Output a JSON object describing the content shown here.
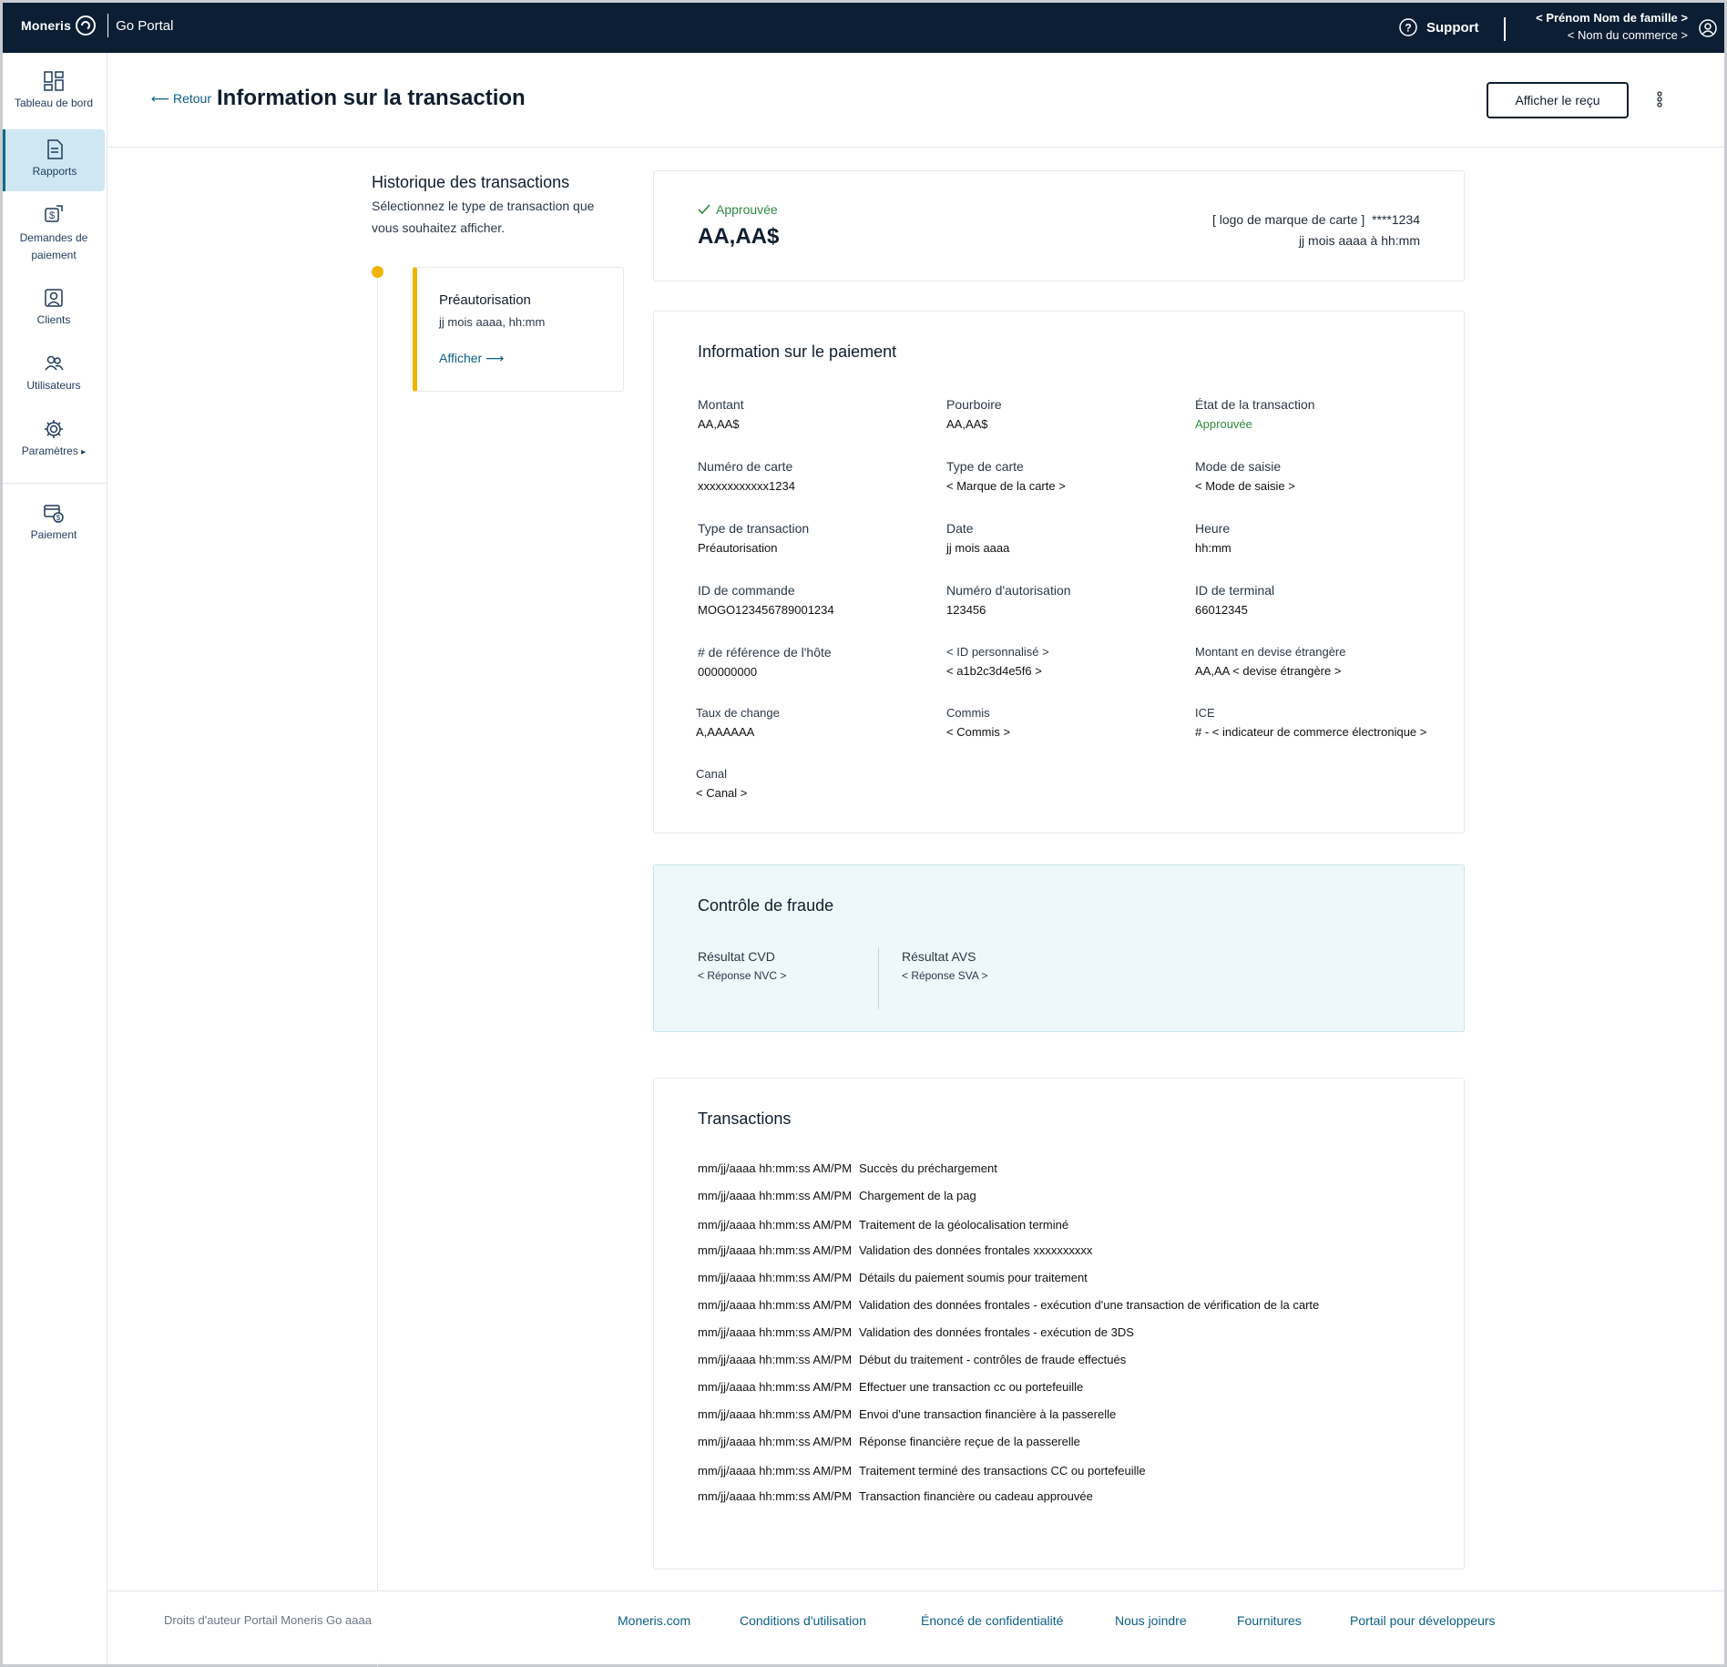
{
  "topbar": {
    "brand": "Moneris",
    "product": "Go Portal",
    "support": "Support",
    "user_name": "< Prénom Nom de famille >",
    "merchant_name": "< Nom du commerce >"
  },
  "sidebar": {
    "items": [
      {
        "label": "Tableau de bord",
        "icon": "dashboard-icon"
      },
      {
        "label": "Rapports",
        "icon": "reports-icon"
      },
      {
        "label": "Demandes de paiement",
        "icon": "payment-requests-icon"
      },
      {
        "label": "Clients",
        "icon": "clients-icon"
      },
      {
        "label": "Utilisateurs",
        "icon": "users-icon"
      },
      {
        "label": "Paramètres",
        "icon": "gear-icon"
      },
      {
        "label": "Paiement",
        "icon": "payment-icon"
      }
    ],
    "active": "Rapports"
  },
  "header": {
    "back": "Retour",
    "title": "Information sur la transaction",
    "receipt_button": "Afficher le reçu"
  },
  "history": {
    "title": "Historique des transactions",
    "subtitle": "Sélectionnez le type de transaction que vous souhaitez afficher.",
    "item": {
      "type": "Préautorisation",
      "date": "jj mois aaaa, hh:mm",
      "link": "Afficher"
    }
  },
  "summary": {
    "status": "Approuvée",
    "amount": "AA,AA$",
    "card_brand": "[ logo de marque de carte ]",
    "card_mask": "****1234",
    "datetime": "jj mois aaaa à hh:mm"
  },
  "payment": {
    "title": "Information sur le paiement",
    "fields": [
      {
        "label": "Montant",
        "value": "AA,AA$"
      },
      {
        "label": "Pourboire",
        "value": "AA,AA$"
      },
      {
        "label": "État de la transaction",
        "value": "Approuvée"
      },
      {
        "label": "Numéro de carte",
        "value": "xxxxxxxxxxxx1234"
      },
      {
        "label": "Type de carte",
        "value": "< Marque de la carte >"
      },
      {
        "label": "Mode de saisie",
        "value": "< Mode de saisie >"
      },
      {
        "label": "Type de transaction",
        "value": "Préautorisation"
      },
      {
        "label": "Date",
        "value": "jj mois aaaa"
      },
      {
        "label": "Heure",
        "value": "hh:mm"
      },
      {
        "label": "ID de commande",
        "value": "MOGO123456789001234"
      },
      {
        "label": "Numéro d'autorisation",
        "value": "123456"
      },
      {
        "label": "ID de terminal",
        "value": "66012345"
      },
      {
        "label": "# de référence de l'hôte",
        "value": "000000000"
      },
      {
        "label": "< ID personnalisé >",
        "value": "< a1b2c3d4e5f6 >"
      },
      {
        "label": "Montant en devise étrangère",
        "value": "AA,AA < devise étrangère >"
      },
      {
        "label": "Taux de change",
        "value": "A,AAAAAA"
      },
      {
        "label": "Commis",
        "value": "< Commis >"
      },
      {
        "label": "ICE",
        "value": "# - < indicateur de commerce électronique >"
      },
      {
        "label": "Canal",
        "value": "< Canal >"
      }
    ]
  },
  "fraud": {
    "title": "Contrôle de fraude",
    "cvd_label": "Résultat CVD",
    "cvd_value": "< Réponse NVC >",
    "avs_label": "Résultat AVS",
    "avs_value": "< Réponse SVA >"
  },
  "transactions": {
    "title": "Transactions",
    "rows": [
      {
        "ts": "mm/jj/aaaa hh:mm:ss AM/PM",
        "msg": "Succès du préchargement"
      },
      {
        "ts": "mm/jj/aaaa hh:mm:ss AM/PM",
        "msg": "Chargement de la pag"
      },
      {
        "ts": "mm/jj/aaaa hh:mm:ss AM/PM",
        "msg": "Traitement de la géolocalisation terminé"
      },
      {
        "ts": "mm/jj/aaaa hh:mm:ss AM/PM",
        "msg": "Validation des données frontales xxxxxxxxxx"
      },
      {
        "ts": "mm/jj/aaaa hh:mm:ss AM/PM",
        "msg": "Détails du paiement soumis pour traitement"
      },
      {
        "ts": "mm/jj/aaaa hh:mm:ss AM/PM",
        "msg": "Validation des données frontales - exécution d'une transaction de vérification de la carte"
      },
      {
        "ts": "mm/jj/aaaa hh:mm:ss AM/PM",
        "msg": "Validation des données frontales - exécution de 3DS"
      },
      {
        "ts": "mm/jj/aaaa hh:mm:ss AM/PM",
        "msg": "Début du traitement - contrôles de fraude effectués"
      },
      {
        "ts": "mm/jj/aaaa hh:mm:ss AM/PM",
        "msg": "Effectuer une transaction cc ou portefeuille"
      },
      {
        "ts": "mm/jj/aaaa hh:mm:ss AM/PM",
        "msg": "Envoi d'une transaction financière à la passerelle"
      },
      {
        "ts": "mm/jj/aaaa hh:mm:ss AM/PM",
        "msg": "Réponse financière reçue de la passerelle"
      },
      {
        "ts": "mm/jj/aaaa hh:mm:ss AM/PM",
        "msg": "Traitement terminé des transactions CC ou portefeuille"
      },
      {
        "ts": "mm/jj/aaaa hh:mm:ss AM/PM",
        "msg": "Transaction financière ou cadeau approuvée"
      }
    ]
  },
  "footer": {
    "copyright": "Droits d'auteur Portail Moneris Go  aaaa",
    "links": [
      "Moneris.com",
      "Conditions d'utilisation",
      "Énoncé de confidentialité",
      "Nous joindre",
      "Fournitures",
      "Portail pour développeurs"
    ]
  },
  "colors": {
    "topbar": "#0b1e33",
    "accent_link": "#0b5f86",
    "approved_green": "#2c8a3f",
    "timeline_yellow": "#f0b400",
    "active_nav": "#cfe7f3",
    "fraud_bg": "#eef8fb"
  }
}
